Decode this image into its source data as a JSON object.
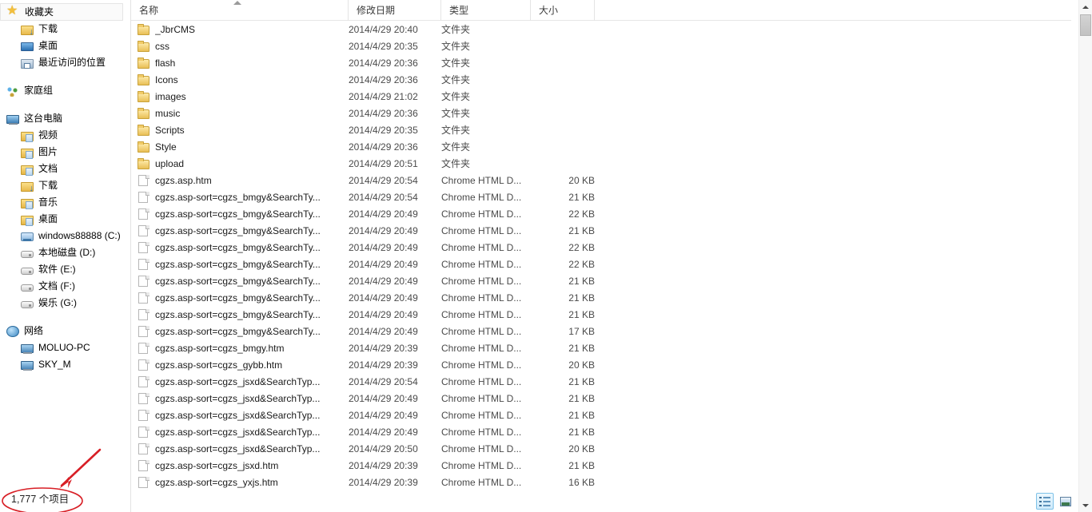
{
  "window": {
    "status_text": "1,777 个项目"
  },
  "sidebar": {
    "groups": [
      {
        "header": {
          "label": "收藏夹",
          "icon": "star-icon",
          "selected": true
        },
        "items": [
          {
            "label": "下载",
            "icon": "downloads-icon"
          },
          {
            "label": "桌面",
            "icon": "desktop-icon"
          },
          {
            "label": "最近访问的位置",
            "icon": "recent-places-icon"
          }
        ]
      },
      {
        "header": {
          "label": "家庭组",
          "icon": "homegroup-icon",
          "selected": false
        },
        "items": []
      },
      {
        "header": {
          "label": "这台电脑",
          "icon": "this-pc-icon",
          "selected": false
        },
        "items": [
          {
            "label": "视频",
            "icon": "videos-folder-icon"
          },
          {
            "label": "图片",
            "icon": "pictures-folder-icon"
          },
          {
            "label": "文档",
            "icon": "documents-folder-icon"
          },
          {
            "label": "下载",
            "icon": "downloads-folder-icon"
          },
          {
            "label": "音乐",
            "icon": "music-folder-icon"
          },
          {
            "label": "桌面",
            "icon": "desktop-folder-icon"
          },
          {
            "label": "windows88888 (C:)",
            "icon": "system-drive-icon"
          },
          {
            "label": "本地磁盘 (D:)",
            "icon": "drive-icon"
          },
          {
            "label": "软件 (E:)",
            "icon": "drive-icon"
          },
          {
            "label": "文档 (F:)",
            "icon": "drive-icon"
          },
          {
            "label": "娱乐 (G:)",
            "icon": "drive-icon"
          }
        ]
      },
      {
        "header": {
          "label": "网络",
          "icon": "network-icon",
          "selected": false
        },
        "items": [
          {
            "label": "MOLUO-PC",
            "icon": "network-computer-icon"
          },
          {
            "label": "SKY_M",
            "icon": "network-computer-icon"
          }
        ]
      }
    ]
  },
  "file_list": {
    "columns": [
      {
        "key": "name",
        "label": "名称",
        "sorted": "asc"
      },
      {
        "key": "date",
        "label": "修改日期",
        "sorted": ""
      },
      {
        "key": "type",
        "label": "类型",
        "sorted": ""
      },
      {
        "key": "size",
        "label": "大小",
        "sorted": ""
      }
    ],
    "rows": [
      {
        "name": "_JbrCMS",
        "date": "2014/4/29 20:40",
        "type": "文件夹",
        "size": "",
        "icon": "folder-icon"
      },
      {
        "name": "css",
        "date": "2014/4/29 20:35",
        "type": "文件夹",
        "size": "",
        "icon": "folder-icon"
      },
      {
        "name": "flash",
        "date": "2014/4/29 20:36",
        "type": "文件夹",
        "size": "",
        "icon": "folder-icon"
      },
      {
        "name": "Icons",
        "date": "2014/4/29 20:36",
        "type": "文件夹",
        "size": "",
        "icon": "folder-icon"
      },
      {
        "name": "images",
        "date": "2014/4/29 21:02",
        "type": "文件夹",
        "size": "",
        "icon": "folder-icon"
      },
      {
        "name": "music",
        "date": "2014/4/29 20:36",
        "type": "文件夹",
        "size": "",
        "icon": "folder-icon"
      },
      {
        "name": "Scripts",
        "date": "2014/4/29 20:35",
        "type": "文件夹",
        "size": "",
        "icon": "folder-icon"
      },
      {
        "name": "Style",
        "date": "2014/4/29 20:36",
        "type": "文件夹",
        "size": "",
        "icon": "folder-icon"
      },
      {
        "name": "upload",
        "date": "2014/4/29 20:51",
        "type": "文件夹",
        "size": "",
        "icon": "folder-icon"
      },
      {
        "name": "cgzs.asp.htm",
        "date": "2014/4/29 20:54",
        "type": "Chrome HTML D...",
        "size": "20 KB",
        "icon": "html-document-icon"
      },
      {
        "name": "cgzs.asp-sort=cgzs_bmgy&SearchTy...",
        "date": "2014/4/29 20:54",
        "type": "Chrome HTML D...",
        "size": "21 KB",
        "icon": "html-document-icon"
      },
      {
        "name": "cgzs.asp-sort=cgzs_bmgy&SearchTy...",
        "date": "2014/4/29 20:49",
        "type": "Chrome HTML D...",
        "size": "22 KB",
        "icon": "html-document-icon"
      },
      {
        "name": "cgzs.asp-sort=cgzs_bmgy&SearchTy...",
        "date": "2014/4/29 20:49",
        "type": "Chrome HTML D...",
        "size": "21 KB",
        "icon": "html-document-icon"
      },
      {
        "name": "cgzs.asp-sort=cgzs_bmgy&SearchTy...",
        "date": "2014/4/29 20:49",
        "type": "Chrome HTML D...",
        "size": "22 KB",
        "icon": "html-document-icon"
      },
      {
        "name": "cgzs.asp-sort=cgzs_bmgy&SearchTy...",
        "date": "2014/4/29 20:49",
        "type": "Chrome HTML D...",
        "size": "22 KB",
        "icon": "html-document-icon"
      },
      {
        "name": "cgzs.asp-sort=cgzs_bmgy&SearchTy...",
        "date": "2014/4/29 20:49",
        "type": "Chrome HTML D...",
        "size": "21 KB",
        "icon": "html-document-icon"
      },
      {
        "name": "cgzs.asp-sort=cgzs_bmgy&SearchTy...",
        "date": "2014/4/29 20:49",
        "type": "Chrome HTML D...",
        "size": "21 KB",
        "icon": "html-document-icon"
      },
      {
        "name": "cgzs.asp-sort=cgzs_bmgy&SearchTy...",
        "date": "2014/4/29 20:49",
        "type": "Chrome HTML D...",
        "size": "21 KB",
        "icon": "html-document-icon"
      },
      {
        "name": "cgzs.asp-sort=cgzs_bmgy&SearchTy...",
        "date": "2014/4/29 20:49",
        "type": "Chrome HTML D...",
        "size": "17 KB",
        "icon": "html-document-icon"
      },
      {
        "name": "cgzs.asp-sort=cgzs_bmgy.htm",
        "date": "2014/4/29 20:39",
        "type": "Chrome HTML D...",
        "size": "21 KB",
        "icon": "html-document-icon"
      },
      {
        "name": "cgzs.asp-sort=cgzs_gybb.htm",
        "date": "2014/4/29 20:39",
        "type": "Chrome HTML D...",
        "size": "20 KB",
        "icon": "html-document-icon"
      },
      {
        "name": "cgzs.asp-sort=cgzs_jsxd&SearchTyp...",
        "date": "2014/4/29 20:54",
        "type": "Chrome HTML D...",
        "size": "21 KB",
        "icon": "html-document-icon"
      },
      {
        "name": "cgzs.asp-sort=cgzs_jsxd&SearchTyp...",
        "date": "2014/4/29 20:49",
        "type": "Chrome HTML D...",
        "size": "21 KB",
        "icon": "html-document-icon"
      },
      {
        "name": "cgzs.asp-sort=cgzs_jsxd&SearchTyp...",
        "date": "2014/4/29 20:49",
        "type": "Chrome HTML D...",
        "size": "21 KB",
        "icon": "html-document-icon"
      },
      {
        "name": "cgzs.asp-sort=cgzs_jsxd&SearchTyp...",
        "date": "2014/4/29 20:49",
        "type": "Chrome HTML D...",
        "size": "21 KB",
        "icon": "html-document-icon"
      },
      {
        "name": "cgzs.asp-sort=cgzs_jsxd&SearchTyp...",
        "date": "2014/4/29 20:50",
        "type": "Chrome HTML D...",
        "size": "20 KB",
        "icon": "html-document-icon"
      },
      {
        "name": "cgzs.asp-sort=cgzs_jsxd.htm",
        "date": "2014/4/29 20:39",
        "type": "Chrome HTML D...",
        "size": "21 KB",
        "icon": "html-document-icon"
      },
      {
        "name": "cgzs.asp-sort=cgzs_yxjs.htm",
        "date": "2014/4/29 20:39",
        "type": "Chrome HTML D...",
        "size": "16 KB",
        "icon": "html-document-icon"
      }
    ]
  },
  "view_buttons": [
    {
      "name": "details-view",
      "active": true
    },
    {
      "name": "large-icons-view",
      "active": false
    }
  ],
  "scrollbar": {
    "up_arrow": "▲",
    "down_arrow": "▼"
  },
  "annotation": {
    "color": "#d81f26",
    "shape": "ellipse-with-arrow"
  }
}
